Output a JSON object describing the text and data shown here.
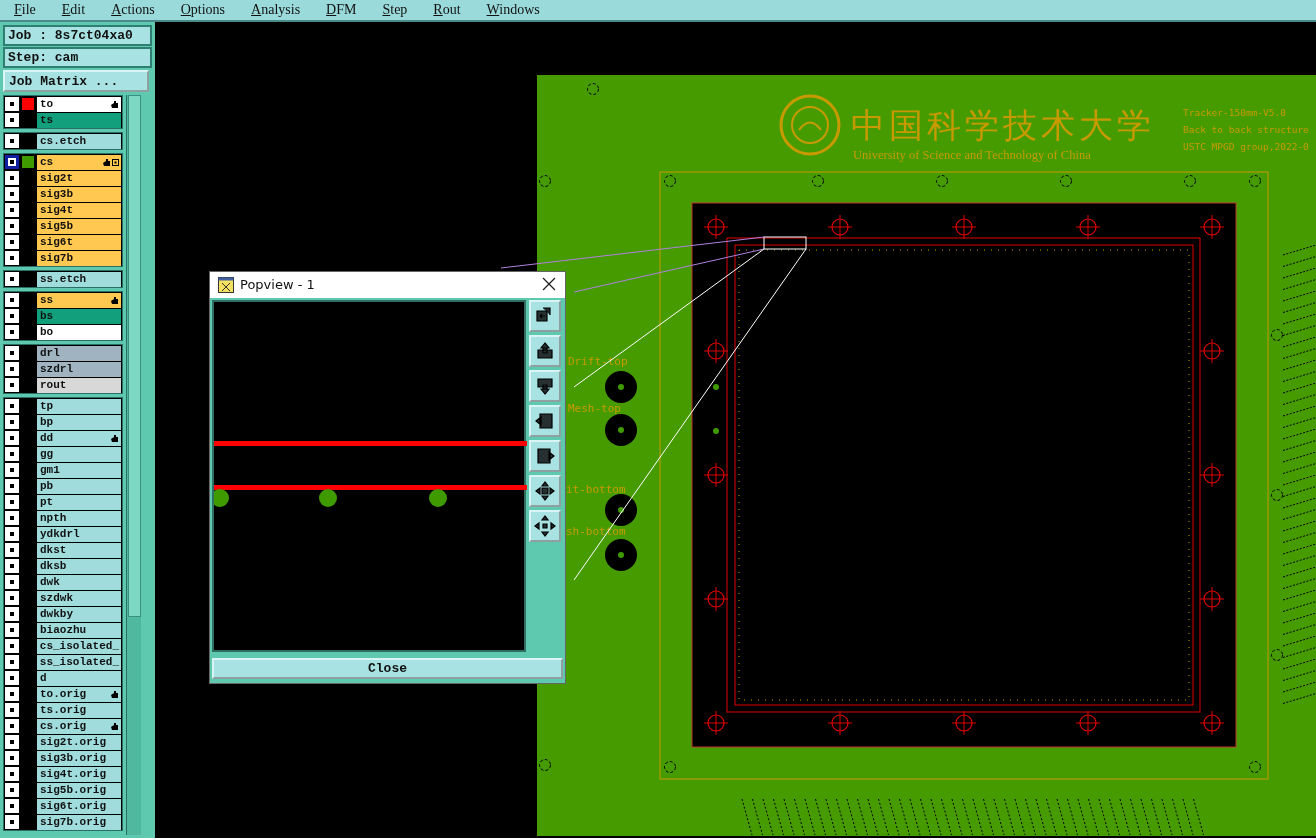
{
  "menu": [
    {
      "label": "File"
    },
    {
      "label": "Edit"
    },
    {
      "label": "Actions"
    },
    {
      "label": "Options"
    },
    {
      "label": "Analysis"
    },
    {
      "label": "DFM"
    },
    {
      "label": "Step"
    },
    {
      "label": "Rout"
    },
    {
      "label": "Windows"
    }
  ],
  "job": {
    "label": "Job : 8s7ct04xa0",
    "step": "Step: cam",
    "matrix_button": "Job Matrix ..."
  },
  "layer_groups": [
    {
      "layers": [
        {
          "name": "to",
          "color": "#ffffff",
          "selected": false,
          "pointer": true,
          "grid": false,
          "swatch": {
            "color": "#ff0000"
          }
        },
        {
          "name": "ts",
          "color": "#12a07c",
          "selected": false,
          "pointer": false,
          "grid": false
        }
      ]
    },
    {
      "layers": [
        {
          "name": "cs.etch",
          "color": "#a0dcdc",
          "selected": false,
          "pointer": false,
          "grid": false
        }
      ]
    },
    {
      "layers": [
        {
          "name": "cs",
          "color": "#ffc850",
          "selected": true,
          "pointer": true,
          "grid": true,
          "swatch": {
            "color": "#3f9a00"
          }
        },
        {
          "name": "sig2t",
          "color": "#ffc850",
          "selected": false,
          "pointer": false,
          "grid": false
        },
        {
          "name": "sig3b",
          "color": "#ffc850",
          "selected": false,
          "pointer": false,
          "grid": false
        },
        {
          "name": "sig4t",
          "color": "#ffc850",
          "selected": false,
          "pointer": false,
          "grid": false
        },
        {
          "name": "sig5b",
          "color": "#ffc850",
          "selected": false,
          "pointer": false,
          "grid": false
        },
        {
          "name": "sig6t",
          "color": "#ffc850",
          "selected": false,
          "pointer": false,
          "grid": false
        },
        {
          "name": "sig7b",
          "color": "#ffc850",
          "selected": false,
          "pointer": false,
          "grid": false
        }
      ]
    },
    {
      "layers": [
        {
          "name": "ss.etch",
          "color": "#a0dcdc",
          "selected": false,
          "pointer": false,
          "grid": false
        }
      ]
    },
    {
      "layers": [
        {
          "name": "ss",
          "color": "#ffc850",
          "selected": false,
          "pointer": true,
          "grid": false
        },
        {
          "name": "bs",
          "color": "#12a07c",
          "selected": false,
          "pointer": false,
          "grid": false
        },
        {
          "name": "bo",
          "color": "#ffffff",
          "selected": false,
          "pointer": false,
          "grid": false
        }
      ]
    },
    {
      "layers": [
        {
          "name": "drl",
          "color": "#9fb4c0",
          "selected": false,
          "pointer": false,
          "grid": false
        },
        {
          "name": "szdrl",
          "color": "#9fb4c0",
          "selected": false,
          "pointer": false,
          "grid": false
        },
        {
          "name": "rout",
          "color": "#d8d8d8",
          "selected": false,
          "pointer": false,
          "grid": false
        }
      ]
    },
    {
      "layers": [
        {
          "name": "tp",
          "color": "#a0dcdc",
          "selected": false,
          "pointer": false,
          "grid": false
        },
        {
          "name": "bp",
          "color": "#a0dcdc",
          "selected": false,
          "pointer": false,
          "grid": false
        },
        {
          "name": "dd",
          "color": "#a0dcdc",
          "selected": false,
          "pointer": true,
          "grid": false
        },
        {
          "name": "gg",
          "color": "#a0dcdc",
          "selected": false,
          "pointer": false,
          "grid": false
        },
        {
          "name": "gm1",
          "color": "#a0dcdc",
          "selected": false,
          "pointer": false,
          "grid": false
        },
        {
          "name": "pb",
          "color": "#a0dcdc",
          "selected": false,
          "pointer": false,
          "grid": false
        },
        {
          "name": "pt",
          "color": "#a0dcdc",
          "selected": false,
          "pointer": false,
          "grid": false
        },
        {
          "name": "npth",
          "color": "#a0dcdc",
          "selected": false,
          "pointer": false,
          "grid": false
        },
        {
          "name": "ydkdrl",
          "color": "#a0dcdc",
          "selected": false,
          "pointer": false,
          "grid": false
        },
        {
          "name": "dkst",
          "color": "#a0dcdc",
          "selected": false,
          "pointer": false,
          "grid": false
        },
        {
          "name": "dksb",
          "color": "#a0dcdc",
          "selected": false,
          "pointer": false,
          "grid": false
        },
        {
          "name": "dwk",
          "color": "#a0dcdc",
          "selected": false,
          "pointer": false,
          "grid": false
        },
        {
          "name": "szdwk",
          "color": "#a0dcdc",
          "selected": false,
          "pointer": false,
          "grid": false
        },
        {
          "name": "dwkby",
          "color": "#a0dcdc",
          "selected": false,
          "pointer": false,
          "grid": false
        },
        {
          "name": "biaozhu",
          "color": "#a0dcdc",
          "selected": false,
          "pointer": false,
          "grid": false
        },
        {
          "name": "cs_isolated_",
          "color": "#a0dcdc",
          "selected": false,
          "pointer": false,
          "grid": false
        },
        {
          "name": "ss_isolated_",
          "color": "#a0dcdc",
          "selected": false,
          "pointer": false,
          "grid": false
        },
        {
          "name": "d",
          "color": "#a0dcdc",
          "selected": false,
          "pointer": false,
          "grid": false
        },
        {
          "name": "to.orig",
          "color": "#a0dcdc",
          "selected": false,
          "pointer": true,
          "grid": false
        },
        {
          "name": "ts.orig",
          "color": "#a0dcdc",
          "selected": false,
          "pointer": false,
          "grid": false
        },
        {
          "name": "cs.orig",
          "color": "#a0dcdc",
          "selected": false,
          "pointer": true,
          "grid": false
        },
        {
          "name": "sig2t.orig",
          "color": "#a0dcdc",
          "selected": false,
          "pointer": false,
          "grid": false
        },
        {
          "name": "sig3b.orig",
          "color": "#a0dcdc",
          "selected": false,
          "pointer": false,
          "grid": false
        },
        {
          "name": "sig4t.orig",
          "color": "#a0dcdc",
          "selected": false,
          "pointer": false,
          "grid": false
        },
        {
          "name": "sig5b.orig",
          "color": "#a0dcdc",
          "selected": false,
          "pointer": false,
          "grid": false
        },
        {
          "name": "sig6t.orig",
          "color": "#a0dcdc",
          "selected": false,
          "pointer": false,
          "grid": false
        },
        {
          "name": "sig7b.orig",
          "color": "#a0dcdc",
          "selected": false,
          "pointer": false,
          "grid": false
        }
      ]
    }
  ],
  "popview": {
    "title": "Popview - 1",
    "close_button": "Close"
  },
  "board": {
    "logo_text": "中国科学技术大学",
    "university": "University of Science and Technology of China",
    "notes": [
      "Tracker-150mm-V5.0",
      "Back to back structure",
      "USTC MPGD group,2022-0"
    ],
    "labels": [
      "Drift-top",
      "Mesh-top",
      "it-bottom",
      "sh-bottom"
    ]
  }
}
